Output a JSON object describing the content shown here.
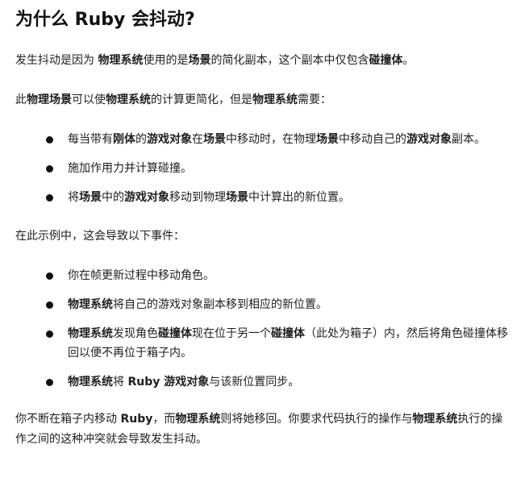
{
  "title": "为什么 Ruby 会抖动?",
  "paragraphs": {
    "intro": [
      {
        "t": "发生抖动是因为 ",
        "b": false
      },
      {
        "t": "物理系统",
        "b": true
      },
      {
        "t": "使用的是",
        "b": false
      },
      {
        "t": "场景",
        "b": true
      },
      {
        "t": "的简化副本，这个副本中仅包含",
        "b": false
      },
      {
        "t": "碰撞体",
        "b": true
      },
      {
        "t": "。",
        "b": false
      }
    ],
    "needs": [
      {
        "t": "此",
        "b": false
      },
      {
        "t": "物理场景",
        "b": true
      },
      {
        "t": "可以使",
        "b": false
      },
      {
        "t": "物理系统",
        "b": true
      },
      {
        "t": "的计算更简化，但是",
        "b": false
      },
      {
        "t": "物理系统",
        "b": true
      },
      {
        "t": "需要：",
        "b": false
      }
    ],
    "example": [
      {
        "t": "在此示例中，这会导致以下事件：",
        "b": false
      }
    ],
    "conclusion": [
      {
        "t": "你不断在箱子内移动 ",
        "b": false
      },
      {
        "t": "Ruby",
        "b": true
      },
      {
        "t": "，而",
        "b": false
      },
      {
        "t": "物理系统",
        "b": true
      },
      {
        "t": "则将她移回。你要求代码执行的操作与",
        "b": false
      },
      {
        "t": "物理系统",
        "b": true
      },
      {
        "t": "执行的操作之间的这种冲突就会导致发生抖动。",
        "b": false
      }
    ]
  },
  "list_needs": [
    [
      {
        "t": "每当带有",
        "b": false
      },
      {
        "t": "刚体",
        "b": true
      },
      {
        "t": "的",
        "b": false
      },
      {
        "t": "游戏对象",
        "b": true
      },
      {
        "t": "在",
        "b": false
      },
      {
        "t": "场景",
        "b": true
      },
      {
        "t": "中移动时，在物理",
        "b": false
      },
      {
        "t": "场景",
        "b": true
      },
      {
        "t": "中移动自己的",
        "b": false
      },
      {
        "t": "游戏对象",
        "b": true
      },
      {
        "t": "副本。",
        "b": false
      }
    ],
    [
      {
        "t": "施加作用力并计算碰撞。",
        "b": false
      }
    ],
    [
      {
        "t": "将",
        "b": false
      },
      {
        "t": "场景",
        "b": true
      },
      {
        "t": "中的",
        "b": false
      },
      {
        "t": "游戏对象",
        "b": true
      },
      {
        "t": "移动到物理",
        "b": false
      },
      {
        "t": "场景",
        "b": true
      },
      {
        "t": "中计算出的新位置。",
        "b": false
      }
    ]
  ],
  "list_events": [
    [
      {
        "t": "你在帧更新过程中移动角色。",
        "b": false
      }
    ],
    [
      {
        "t": "物理系统",
        "b": true
      },
      {
        "t": "将自己的游戏对象副本移到相应的新位置。",
        "b": false
      }
    ],
    [
      {
        "t": "物理系统",
        "b": true
      },
      {
        "t": "发现角色",
        "b": false
      },
      {
        "t": "碰撞体",
        "b": true
      },
      {
        "t": "现在位于另一个",
        "b": false
      },
      {
        "t": "碰撞体",
        "b": true
      },
      {
        "t": "（此处为箱子）内，然后将角色碰撞体移回以便不再位于箱子内。",
        "b": false
      }
    ],
    [
      {
        "t": "物理系统",
        "b": true
      },
      {
        "t": "将 ",
        "b": false
      },
      {
        "t": "Ruby 游戏对象",
        "b": true
      },
      {
        "t": "与该新位置同步。",
        "b": false
      }
    ]
  ]
}
